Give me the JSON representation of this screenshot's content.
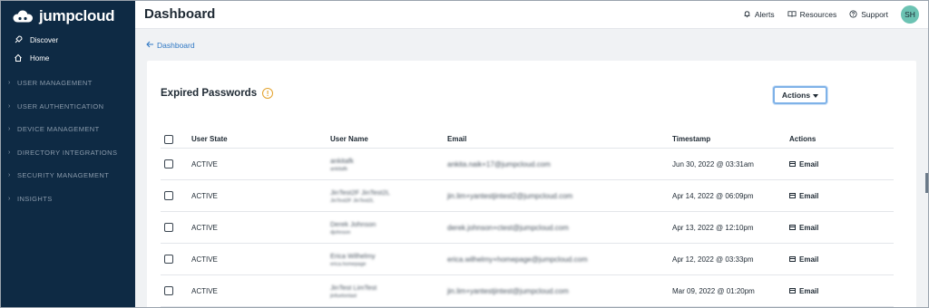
{
  "brand": {
    "name": "jumpcloud"
  },
  "sidebar": {
    "top_items": [
      {
        "label": "Discover",
        "icon": "rocket-icon"
      },
      {
        "label": "Home",
        "icon": "home-icon"
      }
    ],
    "sections": [
      {
        "label": "USER MANAGEMENT"
      },
      {
        "label": "USER AUTHENTICATION"
      },
      {
        "label": "DEVICE MANAGEMENT"
      },
      {
        "label": "DIRECTORY INTEGRATIONS"
      },
      {
        "label": "SECURITY MANAGEMENT"
      },
      {
        "label": "INSIGHTS"
      }
    ]
  },
  "header": {
    "title": "Dashboard",
    "alerts": "Alerts",
    "resources": "Resources",
    "support": "Support",
    "avatar_initials": "SH"
  },
  "breadcrumb": {
    "label": "Dashboard"
  },
  "card": {
    "title": "Expired Passwords",
    "actions_label": "Actions",
    "columns": {
      "state": "User State",
      "user": "User Name",
      "email": "Email",
      "timestamp": "Timestamp",
      "actions": "Actions"
    },
    "rows": [
      {
        "state": "ACTIVE",
        "user": "ankitafk",
        "user_sub": "ankitafk",
        "email": "ankita.naik+17@jumpcloud.com",
        "timestamp": "Jun 30, 2022 @ 03:31am",
        "action": "Email"
      },
      {
        "state": "ACTIVE",
        "user": "JinTest2F JinTest2L",
        "user_sub": "JinTest2F JinTest2L",
        "email": "jin.lim+yantestjintest2@jumpcloud.com",
        "timestamp": "Apr 14, 2022 @ 06:09pm",
        "action": "Email"
      },
      {
        "state": "ACTIVE",
        "user": "Derek Johnson",
        "user_sub": "djohnson",
        "email": "derek.johnson+ctest@jumpcloud.com",
        "timestamp": "Apr 13, 2022 @ 12:10pm",
        "action": "Email"
      },
      {
        "state": "ACTIVE",
        "user": "Erica Wilhelmy",
        "user_sub": "erica.homepage",
        "email": "erica.wilhelmy+homepage@jumpcloud.com",
        "timestamp": "Apr 12, 2022 @ 03:33pm",
        "action": "Email"
      },
      {
        "state": "ACTIVE",
        "user": "JinTest LimTest",
        "user_sub": "jinfuelonlast",
        "email": "jin.lim+yantestjintest@jumpcloud.com",
        "timestamp": "Mar 09, 2022 @ 01:20pm",
        "action": "Email"
      }
    ]
  },
  "colors": {
    "sidebar_bg": "#0e2a44",
    "accent": "#2f78c4",
    "warning": "#e3a12a",
    "avatar_bg": "#6cc3b3"
  }
}
